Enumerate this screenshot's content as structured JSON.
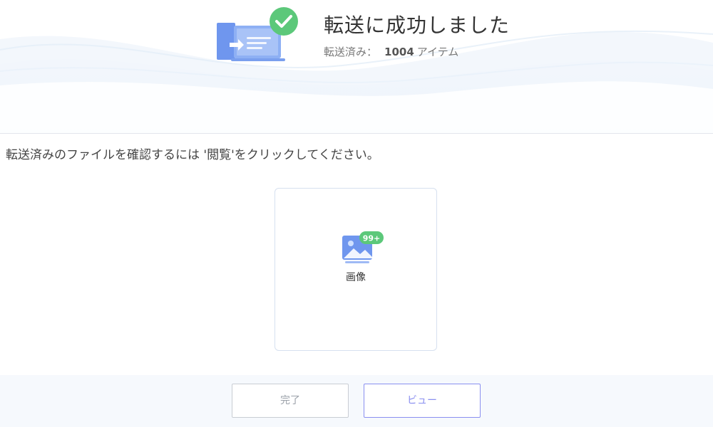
{
  "header": {
    "title": "転送に成功しました",
    "transferred_label": "転送済み：",
    "transferred_count": "1004",
    "transferred_unit": "アイテム"
  },
  "main": {
    "instruction": "転送済みのファイルを確認するには '閲覧'をクリックしてください。",
    "categories": [
      {
        "label": "画像",
        "badge": "99+",
        "icon": "image-icon"
      }
    ]
  },
  "footer": {
    "done_label": "完了",
    "view_label": "ビュー"
  },
  "colors": {
    "success_green": "#5cc87a",
    "accent_blue": "#6f96ee",
    "view_button": "#8a8ff0"
  }
}
